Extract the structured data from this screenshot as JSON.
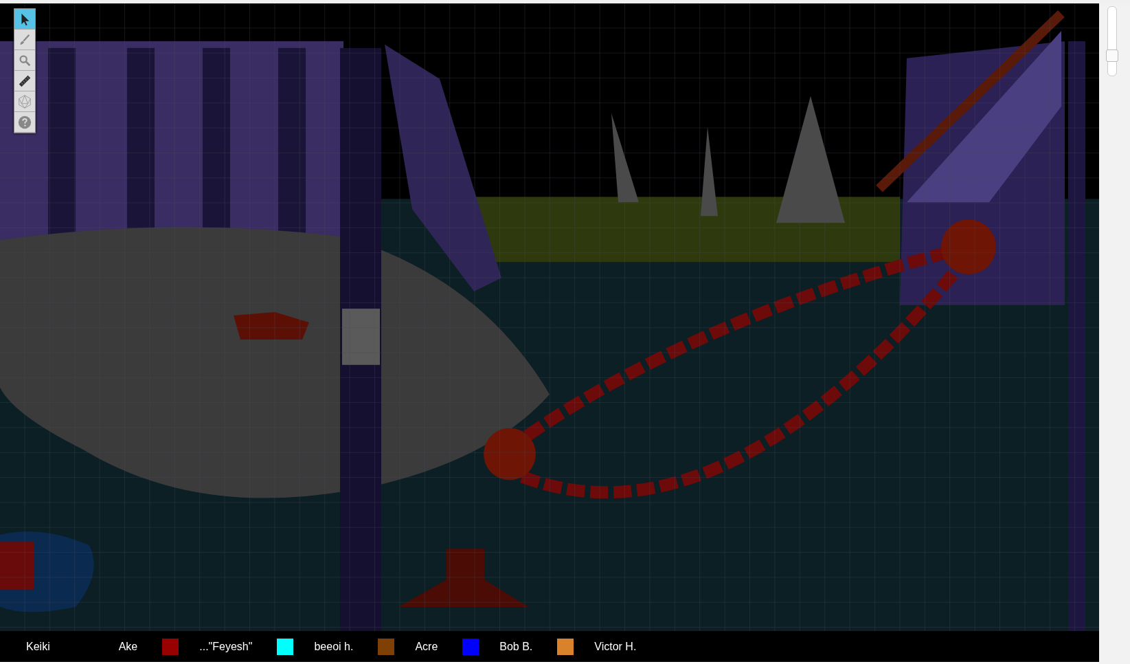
{
  "toolbar": [
    {
      "kind": "select",
      "selected": true
    },
    {
      "kind": "draw",
      "selected": false
    },
    {
      "kind": "zoom",
      "selected": false
    },
    {
      "kind": "measure",
      "selected": false
    },
    {
      "kind": "dice",
      "selected": false
    },
    {
      "kind": "help",
      "selected": false
    }
  ],
  "zoom_slider": {
    "level": 0.3
  },
  "players": [
    {
      "name": "Keiki"
    },
    {
      "name": "Ake",
      "color": "#990000"
    },
    {
      "name": "...\"Feyesh\"",
      "color": "#00ffff"
    },
    {
      "name": "beeoi h.",
      "color": "#7f4006"
    },
    {
      "name": "Acre",
      "color": "#0000ff"
    },
    {
      "name": "Bob B.",
      "color": "#d9822b"
    },
    {
      "name": "Victor H."
    }
  ]
}
